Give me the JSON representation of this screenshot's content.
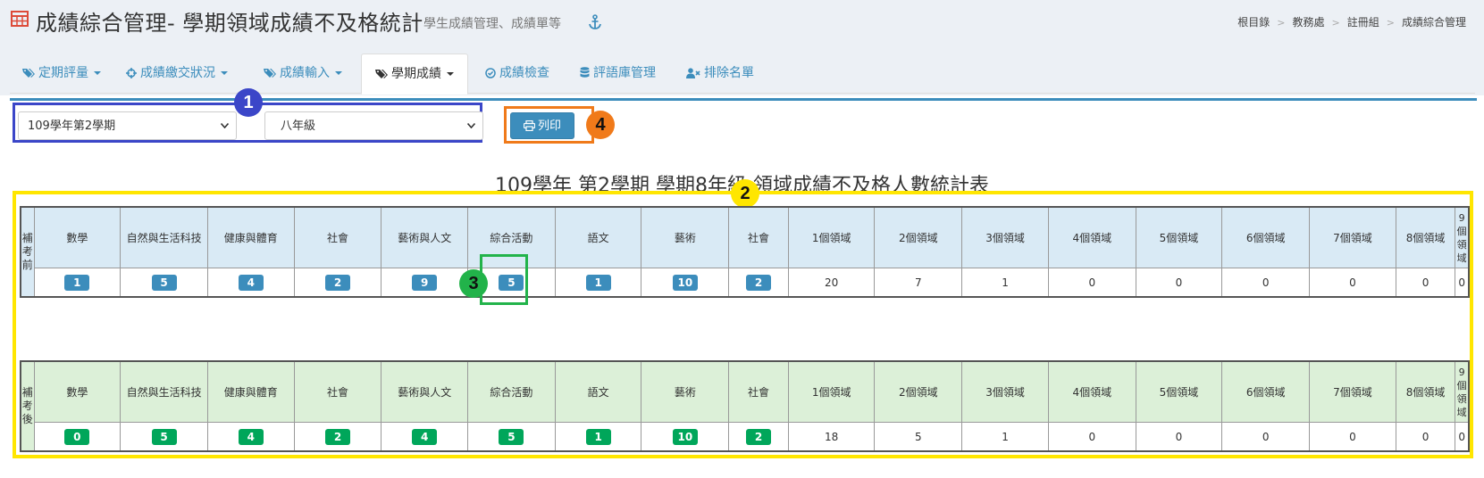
{
  "header": {
    "title": "成績綜合管理- 學期領域成績不及格統計",
    "subtitle": "學生成績管理、成績單等",
    "breadcrumb": [
      "根目錄",
      "教務處",
      "註冊組",
      "成績綜合管理"
    ]
  },
  "tabs": [
    {
      "label": "定期評量",
      "icon": "tags-icon",
      "dropdown": true
    },
    {
      "label": "成績繳交狀況",
      "icon": "crosshairs-icon",
      "dropdown": true
    },
    {
      "label": "成績輸入",
      "icon": "tags-icon",
      "dropdown": true
    },
    {
      "label": "學期成績",
      "icon": "tags-icon",
      "dropdown": true,
      "active": true
    },
    {
      "label": "成績檢查",
      "icon": "check-circle-icon",
      "dropdown": false
    },
    {
      "label": "評語庫管理",
      "icon": "database-icon",
      "dropdown": false
    },
    {
      "label": "排除名單",
      "icon": "user-times-icon",
      "dropdown": false
    }
  ],
  "filters": {
    "semester": "109學年第2學期",
    "grade": "八年級",
    "print_label": "列印"
  },
  "annotations": [
    "1",
    "2",
    "3",
    "4"
  ],
  "annotation_colors": {
    "1": "#3b46c8",
    "2": "#ffe600",
    "3": "#22b34a",
    "4": "#f07a1a"
  },
  "table_title": "109學年 第2學期 學期8年級 領域成績不及格人數統計表",
  "columns": [
    "數學",
    "自然與生活科技",
    "健康與體育",
    "社會",
    "藝術與人文",
    "綜合活動",
    "語文",
    "藝術",
    "社會",
    "1個領域",
    "2個領域",
    "3個領域",
    "4個領域",
    "5個領域",
    "6個領域",
    "7個領域",
    "8個領域",
    "9個領域"
  ],
  "before": {
    "label": "補考前",
    "values": [
      "1",
      "5",
      "4",
      "2",
      "9",
      "5",
      "1",
      "10",
      "2",
      "20",
      "7",
      "1",
      "0",
      "0",
      "0",
      "0",
      "0",
      "0"
    ]
  },
  "after": {
    "label": "補考後",
    "values": [
      "0",
      "5",
      "4",
      "2",
      "4",
      "5",
      "1",
      "10",
      "2",
      "18",
      "5",
      "1",
      "0",
      "0",
      "0",
      "0",
      "0",
      "0"
    ]
  }
}
